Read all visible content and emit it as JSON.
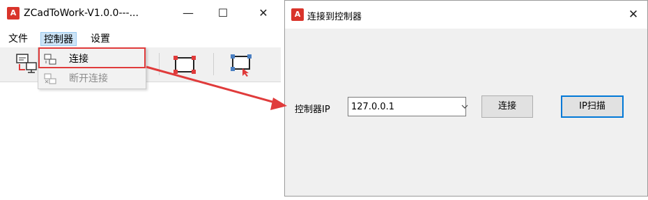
{
  "left_window": {
    "title": "ZCadToWork-V1.0.0---...",
    "app_icon_text": "A",
    "controls": {
      "minimize": "—",
      "maximize": "☐",
      "close": "✕"
    },
    "menus": [
      {
        "label": "文件"
      },
      {
        "label": "控制器"
      },
      {
        "label": "设置"
      }
    ],
    "dropdown": {
      "items": [
        {
          "label": "连接",
          "enabled": true
        },
        {
          "label": "断开连接",
          "enabled": false
        }
      ]
    },
    "toolbar_icons": [
      "connection-status-icon",
      "rectangle-frame-icon",
      "rectangle-select-icon"
    ]
  },
  "dialog": {
    "title": "连接到控制器",
    "app_icon_text": "A",
    "close": "✕",
    "ip_label": "控制器IP",
    "ip_value": "127.0.0.1",
    "connect_button": "连接",
    "scan_button": "IP扫描"
  },
  "colors": {
    "highlight": "#e03b3b",
    "arrow": "#e03b3b",
    "menu_active": "#cce4f7",
    "primary_border": "#0078d7"
  }
}
